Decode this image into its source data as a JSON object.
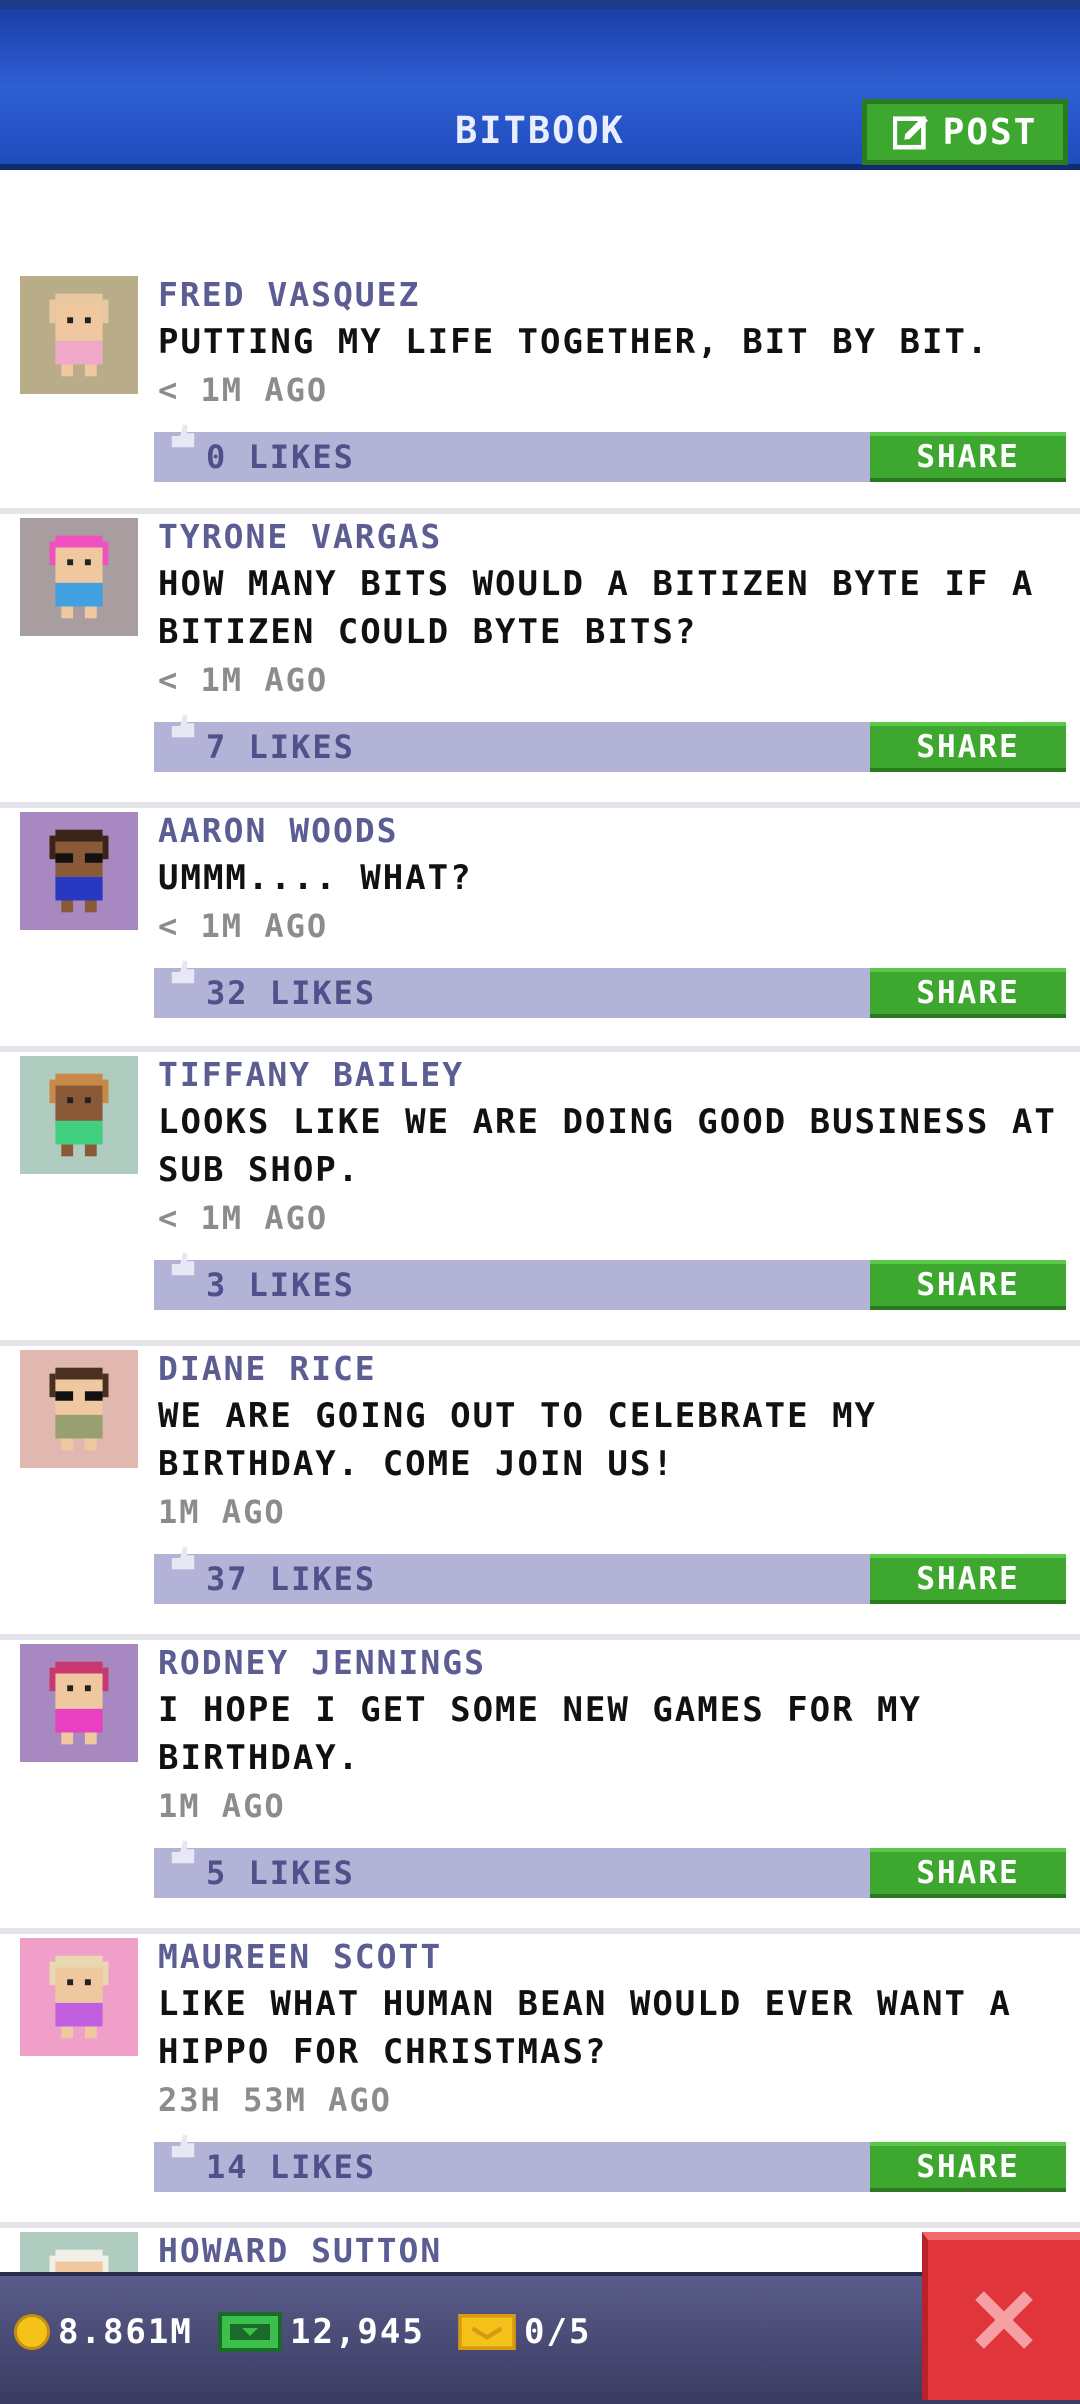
{
  "header": {
    "title": "BITBOOK",
    "post_label": "POST"
  },
  "posts": [
    {
      "author": "FRED VASQUEZ",
      "message": "PUTTING MY LIFE TOGETHER, BIT BY BIT.",
      "time": "< 1M AGO",
      "likes": "0 LIKES",
      "share": "SHARE",
      "avatar": {
        "bg": "#b8ad88",
        "hair": "#e8c8a0",
        "skin": "#f0c8a0",
        "shirt": "#f0a8c8",
        "glasses": false
      }
    },
    {
      "author": "TYRONE VARGAS",
      "message": "HOW MANY BITS WOULD A BITIZEN BYTE IF A BITIZEN COULD BYTE BITS?",
      "time": "< 1M AGO",
      "likes": "7 LIKES",
      "share": "SHARE",
      "avatar": {
        "bg": "#a89ea0",
        "hair": "#f050c0",
        "skin": "#f0c8a0",
        "shirt": "#40a0e0",
        "glasses": false
      }
    },
    {
      "author": "AARON WOODS",
      "message": "UMMM....  WHAT?",
      "time": "< 1M AGO",
      "likes": "32 LIKES",
      "share": "SHARE",
      "avatar": {
        "bg": "#a888c0",
        "hair": "#3a2418",
        "skin": "#8a5a38",
        "shirt": "#2838c0",
        "glasses": true
      }
    },
    {
      "author": "TIFFANY BAILEY",
      "message": "LOOKS LIKE WE ARE DOING GOOD BUSINESS AT SUB SHOP.",
      "time": "< 1M AGO",
      "likes": "3 LIKES",
      "share": "SHARE",
      "avatar": {
        "bg": "#b0ccc0",
        "hair": "#c88848",
        "skin": "#8a5a38",
        "shirt": "#40d080",
        "glasses": false
      }
    },
    {
      "author": "DIANE RICE",
      "message": "WE ARE GOING OUT TO CELEBRATE MY BIRTHDAY. COME JOIN US!",
      "time": "1M AGO",
      "likes": "37 LIKES",
      "share": "SHARE",
      "avatar": {
        "bg": "#e0b8b0",
        "hair": "#4a3020",
        "skin": "#f0c8a0",
        "shirt": "#98a070",
        "glasses": true
      }
    },
    {
      "author": "RODNEY JENNINGS",
      "message": "I HOPE I GET SOME NEW GAMES FOR MY BIRTHDAY.",
      "time": "1M AGO",
      "likes": "5 LIKES",
      "share": "SHARE",
      "avatar": {
        "bg": "#a888c0",
        "hair": "#c83870",
        "skin": "#f0c8a0",
        "shirt": "#e840c0",
        "glasses": false
      }
    },
    {
      "author": "MAUREEN SCOTT",
      "message": "LIKE WHAT HUMAN BEAN WOULD EVER WANT A HIPPO FOR CHRISTMAS?",
      "time": "23H 53M AGO",
      "likes": "14 LIKES",
      "share": "SHARE",
      "avatar": {
        "bg": "#f0a0c8",
        "hair": "#e8d8b0",
        "skin": "#f0c8a0",
        "shirt": "#c060e0",
        "glasses": false
      }
    },
    {
      "author": "HOWARD SUTTON",
      "message": "",
      "time": "",
      "likes": "",
      "share": "",
      "avatar": {
        "bg": "#b0ccc0",
        "hair": "#f0f0e8",
        "skin": "#f0c8a0",
        "shirt": "#60a060",
        "glasses": false
      }
    }
  ],
  "status": {
    "coins": "8.861M",
    "bux": "12,945",
    "tickets": "0/5"
  },
  "colors": {
    "header": "#2f5fd4",
    "accent_green": "#3da72f",
    "likes_bar": "#b3b3d8",
    "close_red": "#e0353a"
  }
}
